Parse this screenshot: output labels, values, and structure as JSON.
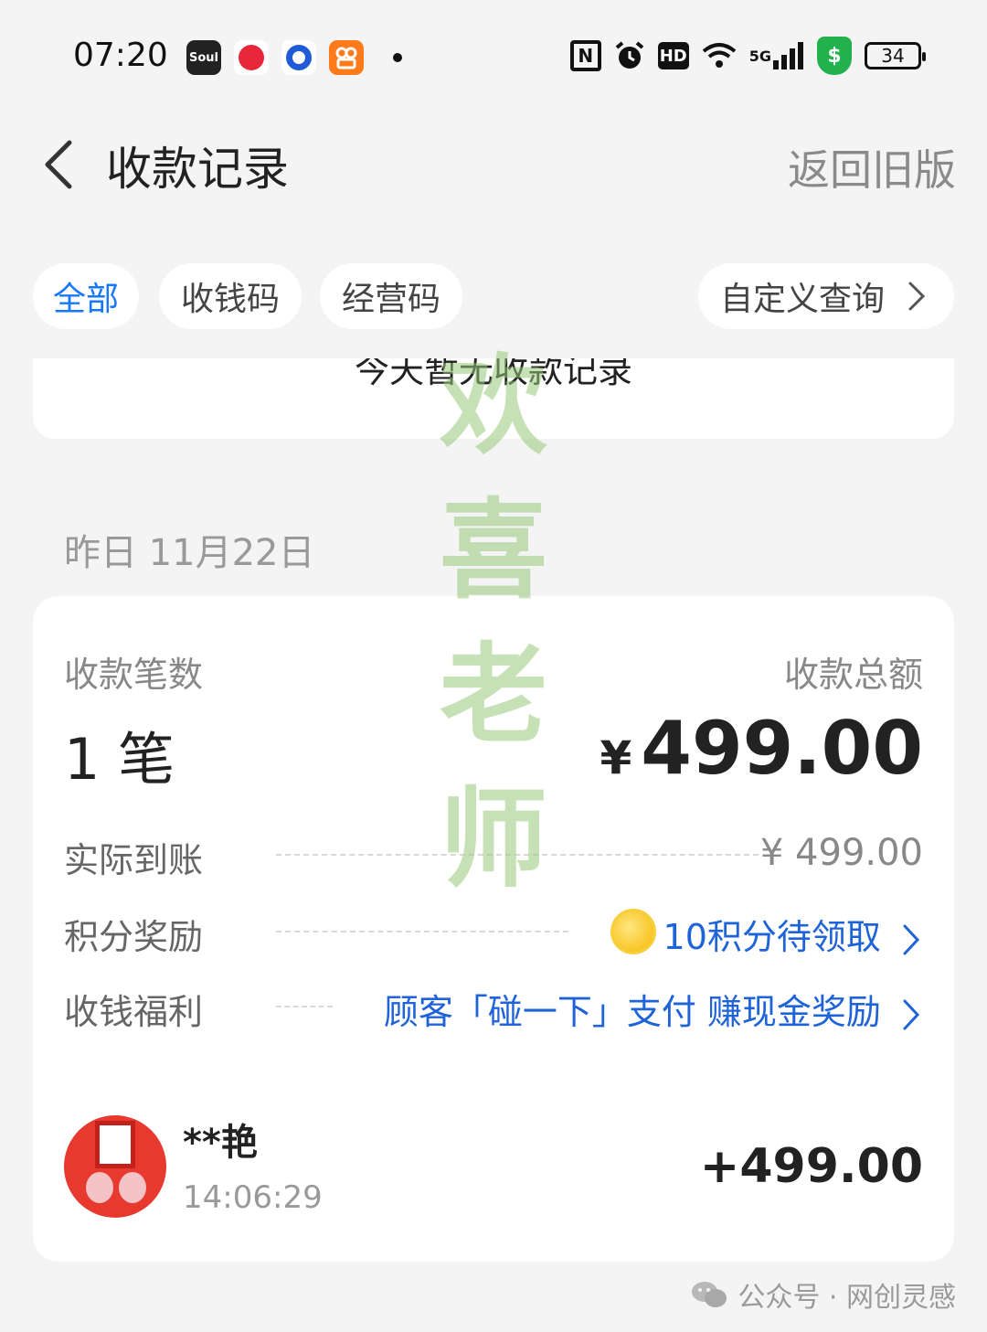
{
  "status_bar": {
    "time": "07:20",
    "app_icons": [
      {
        "name": "soul-app-icon",
        "label": "Soul"
      },
      {
        "name": "red-app-icon",
        "label": ""
      },
      {
        "name": "blue-app-icon",
        "label": ""
      },
      {
        "name": "kuaishou-app-icon",
        "label": ""
      }
    ],
    "battery": "34",
    "network": "5G"
  },
  "header": {
    "title": "收款记录",
    "old_version": "返回旧版"
  },
  "tabs": [
    {
      "label": "全部",
      "active": true
    },
    {
      "label": "收钱码",
      "active": false
    },
    {
      "label": "经营码",
      "active": false
    }
  ],
  "custom_query": "自定义查询",
  "today": {
    "empty_text": "今天暂无收款记录"
  },
  "yesterday": {
    "date_label": "昨日 11月22日",
    "count_label": "收款笔数",
    "count_value": "1 笔",
    "total_label": "收款总额",
    "total_currency": "¥",
    "total_value": "499.00",
    "rows": {
      "actual_label": "实际到账",
      "actual_value": "¥ 499.00",
      "points_label": "积分奖励",
      "points_value": "10积分待领取",
      "benefit_label": "收钱福利",
      "benefit_value": "顾客「碰一下」支付 赚现金奖励"
    },
    "transaction": {
      "payer": "**艳",
      "time": "14:06:29",
      "amount": "+499.00"
    }
  },
  "footer": {
    "watermark": "公众号 · 网创灵感"
  },
  "overlay_watermark": [
    "欢",
    "喜",
    "老",
    "师"
  ],
  "colors": {
    "accent": "#1677ff",
    "link": "#1f63d8",
    "background": "#f4f4f4",
    "watermark": "#96c878"
  }
}
